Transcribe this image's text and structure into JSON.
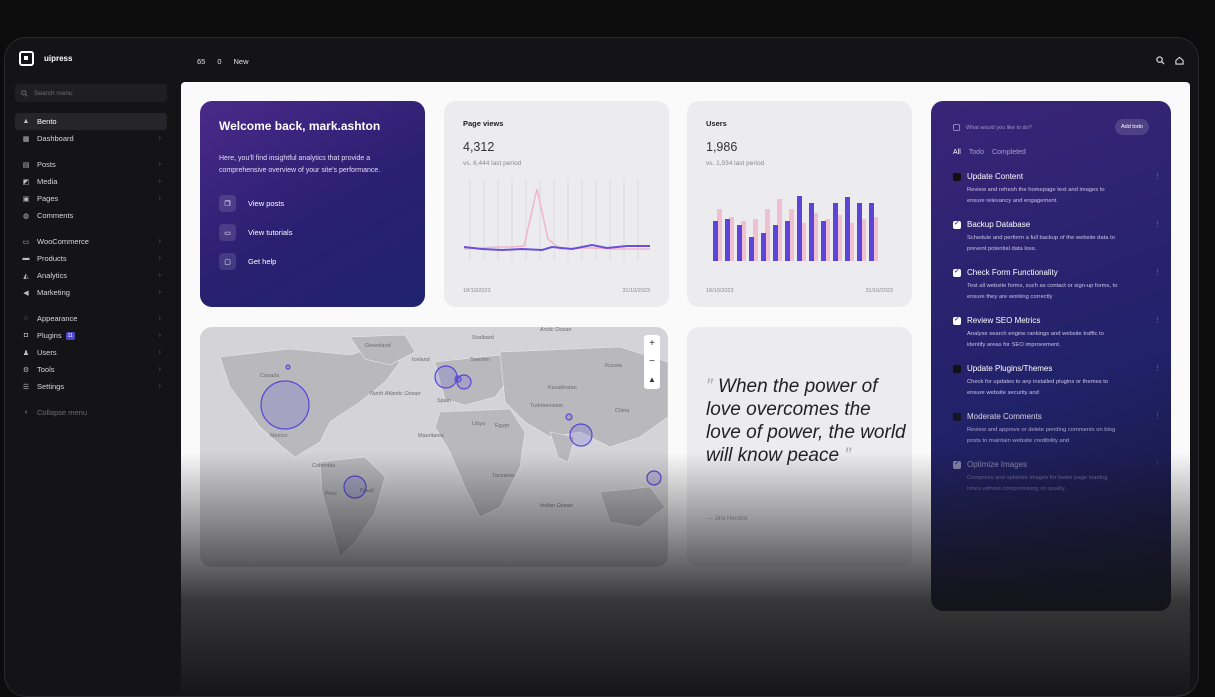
{
  "brand": {
    "name": "uipress"
  },
  "search": {
    "placeholder": "Search menu"
  },
  "topbar": {
    "items": [
      "65",
      "0",
      "New"
    ]
  },
  "sidebar": {
    "items": [
      {
        "label": "Bento",
        "icon": "bento-icon"
      },
      {
        "label": "Dashboard",
        "icon": "dashboard-icon"
      },
      {
        "label": "Posts",
        "icon": "posts-icon"
      },
      {
        "label": "Media",
        "icon": "media-icon"
      },
      {
        "label": "Pages",
        "icon": "pages-icon"
      },
      {
        "label": "Comments",
        "icon": "comments-icon"
      },
      {
        "label": "WooCommerce",
        "icon": "woocommerce-icon"
      },
      {
        "label": "Products",
        "icon": "products-icon"
      },
      {
        "label": "Analytics",
        "icon": "analytics-icon"
      },
      {
        "label": "Marketing",
        "icon": "marketing-icon"
      },
      {
        "label": "Appearance",
        "icon": "appearance-icon"
      },
      {
        "label": "Plugins",
        "icon": "plugins-icon",
        "badge": "11"
      },
      {
        "label": "Users",
        "icon": "users-icon"
      },
      {
        "label": "Tools",
        "icon": "tools-icon"
      },
      {
        "label": "Settings",
        "icon": "settings-icon"
      }
    ],
    "collapse_label": "Collapse menu"
  },
  "welcome": {
    "title": "Welcome back, mark.ashton",
    "description": "Here, you'll find insightful analytics that provide a comprehensive overview of your site's performance.",
    "links": [
      "View posts",
      "View tutorials",
      "Get help"
    ]
  },
  "page_views": {
    "title": "Page views",
    "value": "4,312",
    "comparison": "vs. 6,444 last period",
    "start_date": "18/10/2023",
    "end_date": "31/10/2023"
  },
  "users": {
    "title": "Users",
    "value": "1,986",
    "comparison": "vs. 1,934 last period",
    "start_date": "18/10/2023",
    "end_date": "31/10/2023"
  },
  "map": {
    "labels": [
      "Greenland",
      "Svalbard",
      "Iceland",
      "Sweden",
      "Russia",
      "Canada",
      "Kazakhstan",
      "North Atlantic Ocean",
      "Spain",
      "Turkmenistan",
      "China",
      "Mauritania",
      "Libya",
      "Egypt",
      "Mexico",
      "Colombia",
      "Brazil",
      "Peru",
      "Tanzania",
      "Arctic Ocean",
      "Indian Ocean"
    ],
    "zoom_in": "+",
    "zoom_out": "−"
  },
  "quote": {
    "text": "When the power of love overcomes the love of power, the world will know peace",
    "author": "— Jimi Hendrix"
  },
  "todo": {
    "placeholder": "What would you like to do?",
    "add_label": "Add todo",
    "tabs": [
      "All",
      "Todo",
      "Completed"
    ],
    "items": [
      {
        "title": "Update Content",
        "desc": "Review and refresh the homepage text and images to ensure relevancy and engagement.",
        "done": false
      },
      {
        "title": "Backup Database",
        "desc": "Schedule and perform a full backup of the website data to prevent potential data loss.",
        "done": true
      },
      {
        "title": "Check Form Functionality",
        "desc": "Test all website forms, such as contact or sign-up forms, to ensure they are working correctly",
        "done": true
      },
      {
        "title": "Review SEO Metrics",
        "desc": "Analyse search engine rankings and website traffic to identify areas for SEO improvement.",
        "done": true
      },
      {
        "title": "Update Plugins/Themes",
        "desc": "Check for updates to any installed plugins or themes to ensure website security and",
        "done": false
      },
      {
        "title": "Moderate Comments",
        "desc": "Review and approve or delete pending comments on blog posts to maintain website credibility and",
        "done": false
      },
      {
        "title": "Optimize Images",
        "desc": "Compress and optimise images for faster page loading times without compromising on quality.",
        "done": true
      }
    ]
  },
  "colors": {
    "accent": "#5a45d6",
    "sidebar_bg": "#141416",
    "card_purple": "#2a1f70"
  }
}
